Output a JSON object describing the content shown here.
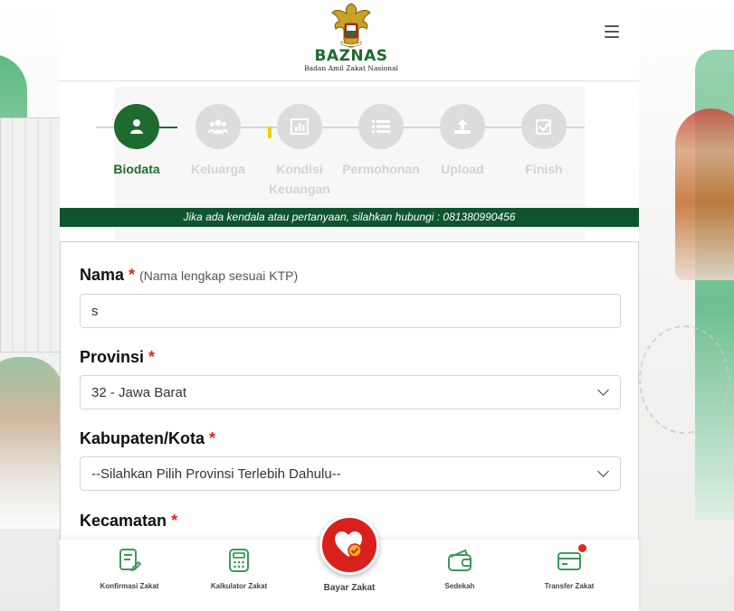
{
  "brand": {
    "name": "BAZNAS",
    "subtitle": "Badan Amil Zakat Nasional"
  },
  "steps": [
    {
      "label": "Biodata",
      "icon": "user-icon",
      "active": true
    },
    {
      "label": "Keluarga",
      "icon": "users-icon",
      "active": false
    },
    {
      "label": "Kondisi Keuangan",
      "icon": "bar-chart-icon",
      "active": false
    },
    {
      "label": "Permohonan",
      "icon": "list-icon",
      "active": false
    },
    {
      "label": "Upload",
      "icon": "upload-icon",
      "active": false
    },
    {
      "label": "Finish",
      "icon": "check-square-icon",
      "active": false
    }
  ],
  "contact_notice": "Jika ada kendala atau pertanyaan, silahkan hubungi : 081380990456",
  "form": {
    "nama": {
      "label": "Nama",
      "required": "*",
      "hint": "(Nama lengkap sesuai KTP)",
      "value": "s"
    },
    "provinsi": {
      "label": "Provinsi",
      "required": "*",
      "value": "32 - Jawa Barat"
    },
    "kabupaten": {
      "label": "Kabupaten/Kota",
      "required": "*",
      "value": "--Silahkan Pilih Provinsi Terlebih Dahulu--"
    },
    "kecamatan": {
      "label": "Kecamatan",
      "required": "*"
    }
  },
  "bottom_nav": {
    "konfirmasi": "Konfirmasi Zakat",
    "kalkulator": "Kalkulator Zakat",
    "bayar": "Bayar Zakat",
    "sedekah": "Sedekah",
    "transfer": "Transfer Zakat"
  },
  "colors": {
    "primary_green": "#1e6b2f",
    "banner_green": "#0f5430",
    "required_red": "#e0271f",
    "nav_icon_green": "#3a9a5b",
    "cta_red": "#d9201c"
  }
}
